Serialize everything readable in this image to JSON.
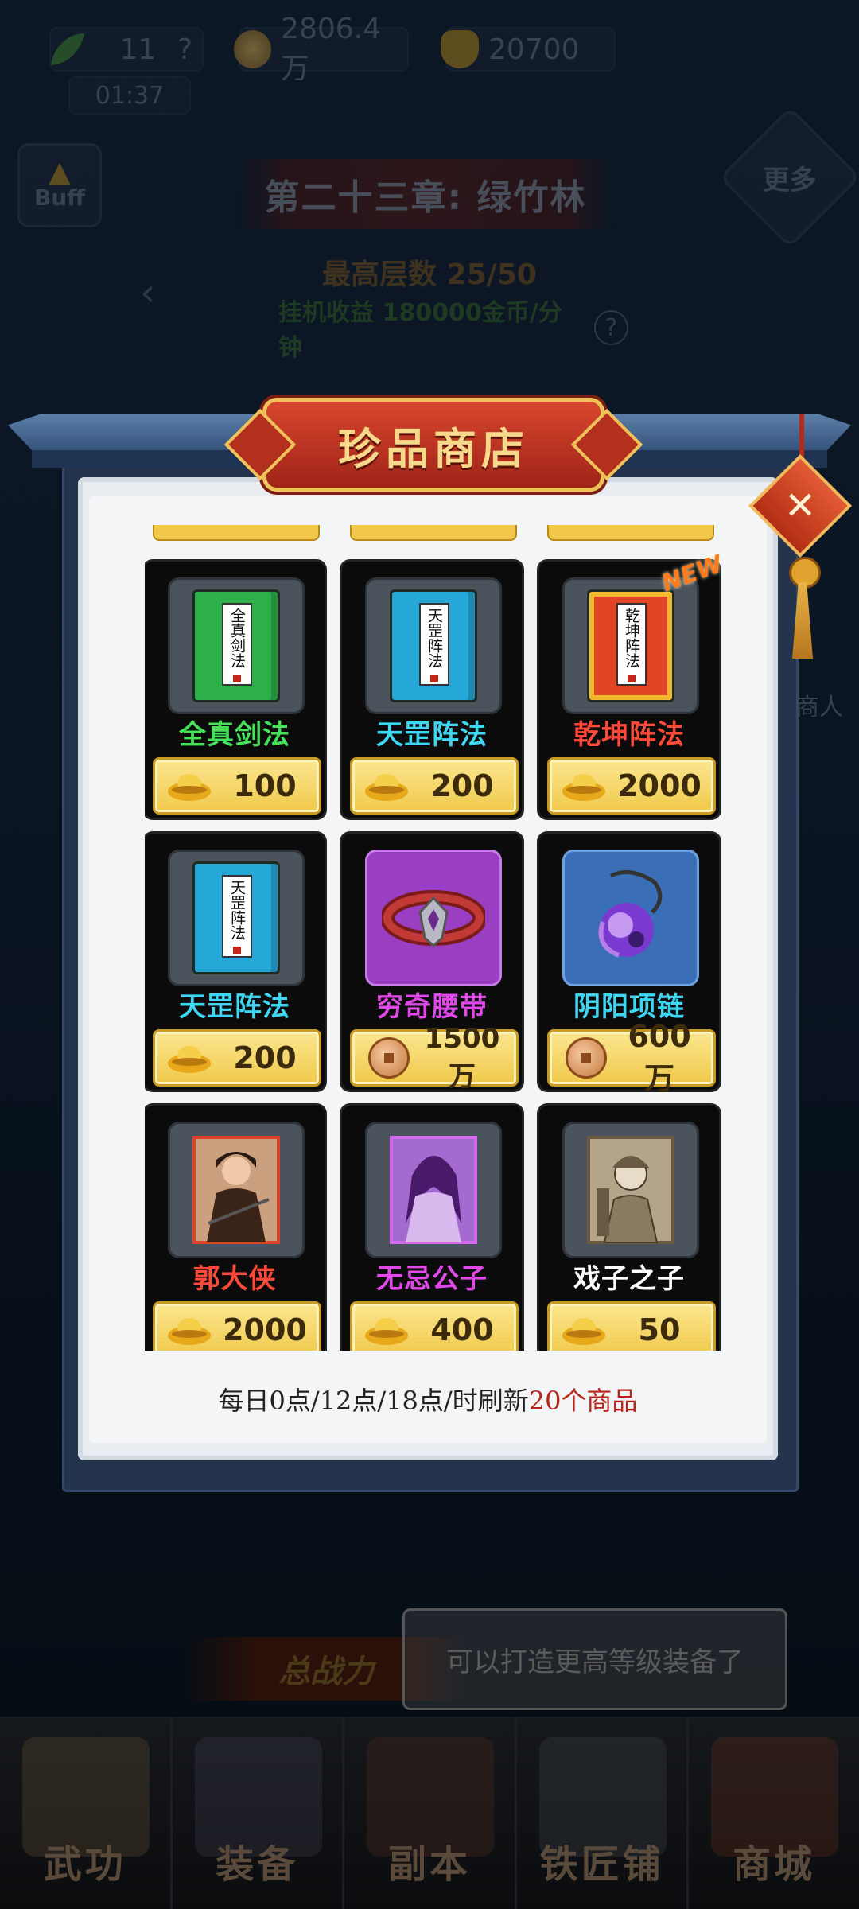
{
  "hud": {
    "stamina": "11",
    "stamina_help": "?",
    "timer": "01:37",
    "gold": "2806.4万",
    "ingots": "20700",
    "buff_label": "Buff",
    "more_label": "更多"
  },
  "stage": {
    "chapter_title": "第二十三章: 绿竹林",
    "max_floor": "最高层数 25/50",
    "idle_income": "挂机收益 180000金币/分钟",
    "help": "?",
    "side_npc": "商人"
  },
  "shop": {
    "title": "珍品商店",
    "close_icon": "✕",
    "new_badge": "NEW",
    "refresh_note_prefix": "每日0点/12点/18点/时刷新",
    "refresh_note_highlight": "20个商品",
    "items": [
      {
        "name": "全真剑法",
        "price": "100",
        "currency": "ingot",
        "name_color": "#47e05a",
        "book_color": "#2db04a",
        "book_text": "全真剑法"
      },
      {
        "name": "天罡阵法",
        "price": "200",
        "currency": "ingot",
        "name_color": "#3fd6f2",
        "book_color": "#25a8d8",
        "book_text": "天罡阵法"
      },
      {
        "name": "乾坤阵法",
        "price": "2000",
        "currency": "ingot",
        "name_color": "#ff4a3a",
        "book_color": "#e04526",
        "book_text": "乾坤阵法",
        "is_new": true
      },
      {
        "name": "天罡阵法",
        "price": "200",
        "currency": "ingot",
        "name_color": "#3fd6f2",
        "book_color": "#25a8d8",
        "book_text": "天罡阵法"
      },
      {
        "name": "穷奇腰带",
        "price": "1500万",
        "currency": "coin",
        "name_color": "#e048e8",
        "icon": "belt-icon"
      },
      {
        "name": "阴阳项链",
        "price": "600万",
        "currency": "coin",
        "name_color": "#3fd6f2",
        "icon": "necklace-icon"
      },
      {
        "name": "郭大侠",
        "price": "2000",
        "currency": "ingot",
        "name_color": "#ff4a3a",
        "icon": "hero-portrait-icon"
      },
      {
        "name": "无忌公子",
        "price": "400",
        "currency": "ingot",
        "name_color": "#e048e8",
        "icon": "hero-portrait-icon"
      },
      {
        "name": "戏子之子",
        "price": "50",
        "currency": "ingot",
        "name_color": "#ffffff",
        "icon": "hero-portrait-icon"
      }
    ]
  },
  "toast": "可以打造更高等级装备了",
  "power_banner": "总战力",
  "tabs": [
    {
      "label": "武功",
      "icon": "scroll-icon"
    },
    {
      "label": "装备",
      "icon": "armor-icon"
    },
    {
      "label": "副本",
      "icon": "swords-icon"
    },
    {
      "label": "铁匠铺",
      "icon": "anvil-icon"
    },
    {
      "label": "商城",
      "icon": "shop-icon"
    }
  ],
  "colors": {
    "gold_button": "#f0c94a",
    "highlight_red": "#b7241a",
    "title_red": "#c0341f"
  }
}
